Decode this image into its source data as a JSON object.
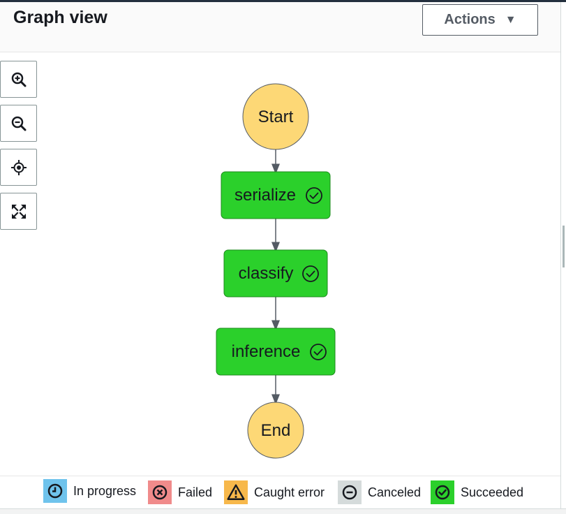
{
  "header": {
    "title": "Graph view",
    "actions_label": "Actions"
  },
  "zoom_controls": [
    {
      "name": "zoom-in-button",
      "icon": "zoom-in-icon"
    },
    {
      "name": "zoom-out-button",
      "icon": "zoom-out-icon"
    },
    {
      "name": "center-button",
      "icon": "crosshair-icon"
    },
    {
      "name": "fit-view-button",
      "icon": "expand-icon"
    }
  ],
  "graph": {
    "nodes": [
      {
        "id": "start",
        "label": "Start",
        "kind": "terminal"
      },
      {
        "id": "serialize",
        "label": "serialize",
        "kind": "task",
        "status": "Succeeded"
      },
      {
        "id": "classify",
        "label": "classify",
        "kind": "task",
        "status": "Succeeded"
      },
      {
        "id": "inference",
        "label": "inference",
        "kind": "task",
        "status": "Succeeded"
      },
      {
        "id": "end",
        "label": "End",
        "kind": "terminal"
      }
    ],
    "edges": [
      [
        "start",
        "serialize"
      ],
      [
        "serialize",
        "classify"
      ],
      [
        "classify",
        "inference"
      ],
      [
        "inference",
        "end"
      ]
    ]
  },
  "legend": [
    {
      "label": "In progress",
      "color": "#6fc3ec",
      "icon": "clock-icon"
    },
    {
      "label": "Failed",
      "color": "#f08b8b",
      "icon": "x-circle-icon"
    },
    {
      "label": "Caught error",
      "color": "#f7b84b",
      "icon": "warning-icon"
    },
    {
      "label": "Canceled",
      "color": "#d5dbdb",
      "icon": "minus-circle-icon"
    },
    {
      "label": "Succeeded",
      "color": "#2bd02b",
      "icon": "check-circle-icon"
    }
  ],
  "colors": {
    "terminal": "#fdd876",
    "succeeded": "#2bd02b",
    "edge": "#545b64"
  }
}
